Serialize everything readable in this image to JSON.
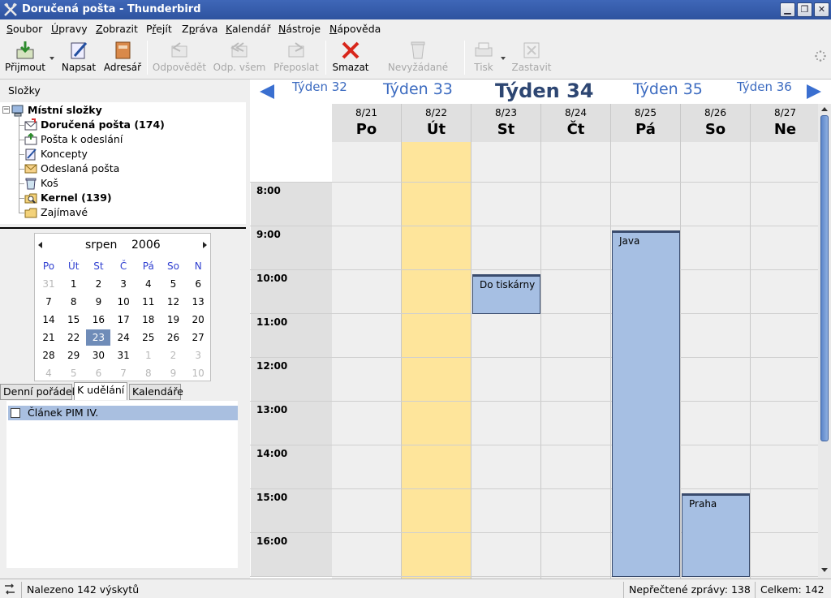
{
  "window": {
    "title": "Doručená pošta - Thunderbird"
  },
  "menu": [
    {
      "label": "Soubor",
      "mn": 0
    },
    {
      "label": "Úpravy",
      "mn": 0
    },
    {
      "label": "Zobrazit",
      "mn": 0
    },
    {
      "label": "Přejít",
      "mn": 1
    },
    {
      "label": "Zpráva",
      "mn": 1
    },
    {
      "label": "Kalendář",
      "mn": 0
    },
    {
      "label": "Nástroje",
      "mn": 0
    },
    {
      "label": "Nápověda",
      "mn": 0
    }
  ],
  "toolbar": {
    "get": "Přijmout",
    "write": "Napsat",
    "addressbook": "Adresář",
    "reply": "Odpovědět",
    "reply_all": "Odp. všem",
    "forward": "Přeposlat",
    "delete": "Smazat",
    "junk": "Nevyžádané",
    "print": "Tisk",
    "stop": "Zastavit"
  },
  "folders": {
    "header": "Složky",
    "root": "Místní složky",
    "items": [
      {
        "label": "Doručená pošta (174)",
        "icon": "inbox-icon",
        "bold": true
      },
      {
        "label": "Pošta k odeslání",
        "icon": "outbox-icon",
        "bold": false
      },
      {
        "label": "Koncepty",
        "icon": "drafts-icon",
        "bold": false
      },
      {
        "label": "Odeslaná pošta",
        "icon": "sent-icon",
        "bold": false
      },
      {
        "label": "Koš",
        "icon": "trash-icon",
        "bold": false
      },
      {
        "label": "Kernel (139)",
        "icon": "search-folder-icon",
        "bold": true
      },
      {
        "label": "Zajímavé",
        "icon": "folder-icon",
        "bold": false
      }
    ]
  },
  "minical": {
    "month": "srpen",
    "year": "2006",
    "dow": [
      "Po",
      "Út",
      "St",
      "Č",
      "Pá",
      "So",
      "N"
    ],
    "weeks": [
      [
        "31",
        "1",
        "2",
        "3",
        "4",
        "5",
        "6"
      ],
      [
        "7",
        "8",
        "9",
        "10",
        "11",
        "12",
        "13"
      ],
      [
        "14",
        "15",
        "16",
        "17",
        "18",
        "19",
        "20"
      ],
      [
        "21",
        "22",
        "23",
        "24",
        "25",
        "26",
        "27"
      ],
      [
        "28",
        "29",
        "30",
        "31",
        "1",
        "2",
        "3"
      ],
      [
        "4",
        "5",
        "6",
        "7",
        "8",
        "9",
        "10"
      ]
    ],
    "selected": "23"
  },
  "tabs": [
    {
      "label": "Denní pořádek",
      "active": false
    },
    {
      "label": "K udělání",
      "active": true
    },
    {
      "label": "Kalendáře",
      "active": false
    }
  ],
  "todo": [
    {
      "label": "Článek PIM IV.",
      "done": false
    }
  ],
  "weeknav": {
    "w32": "Týden 32",
    "w33": "Týden 33",
    "w34": "Týden 34",
    "w35": "Týden 35",
    "w36": "Týden 36"
  },
  "days": [
    {
      "date": "8/21",
      "name": "Po",
      "today": false
    },
    {
      "date": "8/22",
      "name": "Út",
      "today": true
    },
    {
      "date": "8/23",
      "name": "St",
      "today": false
    },
    {
      "date": "8/24",
      "name": "Čt",
      "today": false
    },
    {
      "date": "8/25",
      "name": "Pá",
      "today": false
    },
    {
      "date": "8/26",
      "name": "So",
      "today": false
    },
    {
      "date": "8/27",
      "name": "Ne",
      "today": false
    }
  ],
  "hours": [
    "8:00",
    "9:00",
    "10:00",
    "11:00",
    "12:00",
    "13:00",
    "14:00",
    "15:00",
    "16:00"
  ],
  "events": [
    {
      "title": "Do tiskárny",
      "day": 2,
      "start": 10,
      "end": 11
    },
    {
      "title": "Java",
      "day": 4,
      "start": 9,
      "end": 17
    },
    {
      "title": "Praha",
      "day": 5,
      "start": 15,
      "end": 17
    }
  ],
  "status": {
    "found": "Nalezeno 142 výskytů",
    "unread": "Nepřečtené zprávy: 138",
    "total": "Celkem: 142"
  },
  "colors": {
    "titlebar": "#2e539f",
    "today_column": "#fee59b",
    "event": "#a6bfe3",
    "week_nav": "#3c6bc0"
  }
}
